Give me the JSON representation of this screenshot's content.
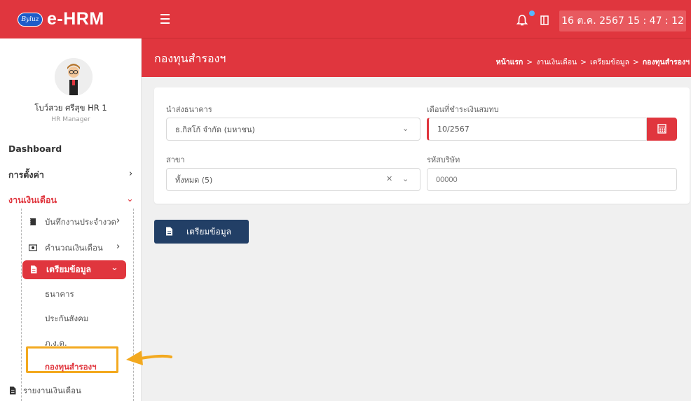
{
  "app": {
    "logo_badge": "Byluz",
    "logo_text": "e-HRM"
  },
  "topbar": {
    "datetime": "16 ต.ค. 2567  15 : 47 : 12"
  },
  "page": {
    "title": "กองทุนสำรองฯ",
    "breadcrumb": {
      "home": "หน้าแรก",
      "level1": "งานเงินเดือน",
      "level2": "เตรียมข้อมูล",
      "current": "กองทุนสำรองฯ",
      "separator": ">"
    }
  },
  "user": {
    "name": "โบว์สวย ศรีสุข HR 1",
    "role": "HR Manager"
  },
  "sidebar": {
    "dashboard": "Dashboard",
    "settings": "การตั้งค่า",
    "payroll": "งานเงินเดือน",
    "sub": {
      "daily_record": "บันทึกงานประจำงวด",
      "calc_salary": "คำนวณเงินเดือน",
      "prepare_data": "เตรียมข้อมูล",
      "bank": "ธนาคาร",
      "social_security": "ประกันสังคม",
      "pnd": "ภ.ง.ด.",
      "provident_fund": "กองทุนสำรองฯ",
      "salary_report": "รายงานเงินเดือน"
    }
  },
  "form": {
    "bank_label": "นำส่งธนาคาร",
    "bank_value": "ธ.กิสโก้ จำกัด (มหาชน)",
    "month_label": "เดือนที่ชำระเงินสมทบ",
    "month_value": "10/2567",
    "branch_label": "สาขา",
    "branch_value": "ทั้งหมด (5)",
    "company_code_label": "รหัสบริษัท",
    "company_code_placeholder": "00000"
  },
  "actions": {
    "prepare_button": "เตรียมข้อมูล"
  },
  "colors": {
    "primary_red": "#e0363e",
    "navy": "#223f66",
    "highlight": "#f3a91f"
  }
}
